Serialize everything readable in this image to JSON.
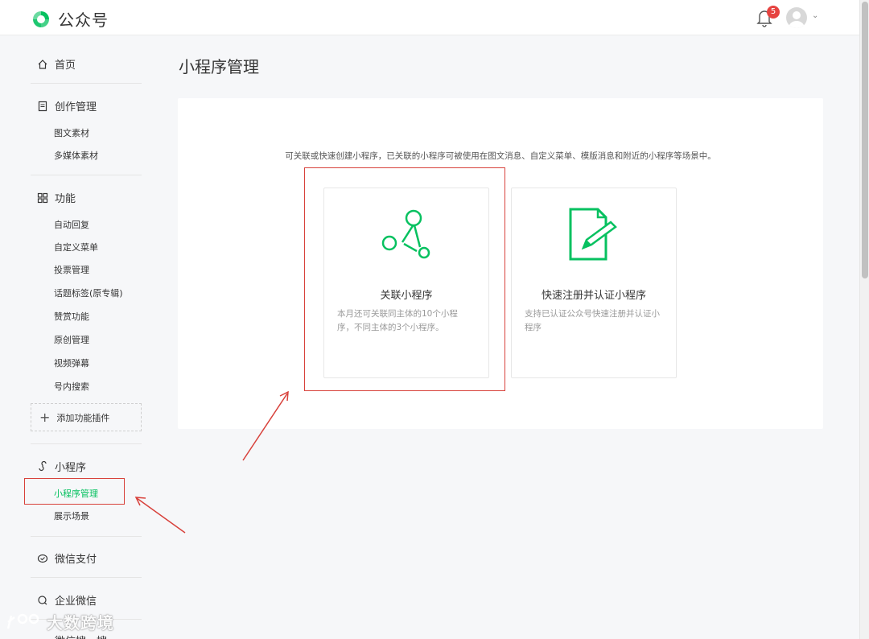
{
  "header": {
    "app_title": "公众号",
    "notification_count": "5",
    "brand_color": "#07c160"
  },
  "sidebar": {
    "home": "首页",
    "creation": {
      "label": "创作管理",
      "items": [
        "图文素材",
        "多媒体素材"
      ]
    },
    "features": {
      "label": "功能",
      "items": [
        "自动回复",
        "自定义菜单",
        "投票管理",
        "话题标签(原专辑)",
        "赞赏功能",
        "原创管理",
        "视频弹幕",
        "号内搜索"
      ]
    },
    "add_plugin": "添加功能插件",
    "miniprogram": {
      "label": "小程序",
      "items": [
        "小程序管理",
        "展示场景"
      ],
      "active_item": "小程序管理"
    },
    "wechat_pay": "微信支付",
    "work_wechat": "企业微信",
    "next_section_partial": "微信搜一搜"
  },
  "main": {
    "page_title": "小程序管理",
    "intro": "可关联或快速创建小程序，已关联的小程序可被使用在图文消息、自定义菜单、模版消息和附近的小程序等场景中。",
    "cards": [
      {
        "title": "关联小程序",
        "desc": "本月还可关联同主体的10个小程序，不同主体的3个小程序。",
        "icon": "link-nodes-icon"
      },
      {
        "title": "快速注册并认证小程序",
        "desc": "支持已认证公众号快速注册并认证小程序",
        "icon": "document-pen-icon"
      }
    ]
  },
  "watermark": "大数跨境",
  "annotation_color": "#d8413b"
}
